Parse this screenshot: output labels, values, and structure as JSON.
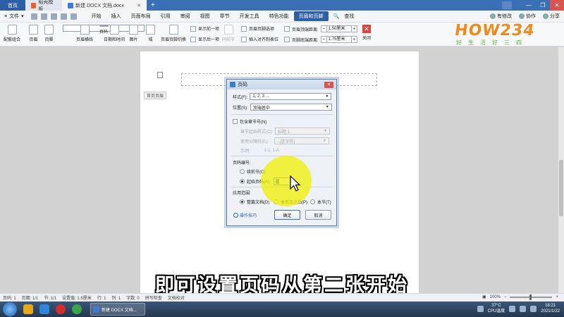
{
  "tabs": {
    "home": "首页",
    "template": "稻壳模板",
    "document": "新建 DOCX 文档.docx"
  },
  "menubar": {
    "file": "文件",
    "items": [
      "开始",
      "插入",
      "页面布局",
      "引用",
      "审阅",
      "视图",
      "章节",
      "开发工具",
      "特色功能",
      "页眉和页脚"
    ],
    "active_index": 9,
    "search": "查找",
    "right": [
      "有修改",
      "协作",
      "分享"
    ]
  },
  "ribbon": {
    "buttons": [
      "配套组合",
      "页眉",
      "页脚",
      "页码",
      "页眉横线",
      "日期和时间",
      "图片",
      "域",
      "页眉页脚切换",
      "同前节",
      "关闭"
    ],
    "small": {
      "show_prev": "显示前一项",
      "show_next": "显示后一项",
      "options": "页眉页脚选项",
      "insert_align_tab": "插入对齐制表位",
      "header_top": "页眉顶端距离:",
      "footer_bottom": "页脚底端距离:",
      "header_value": "1.50厘米",
      "footer_value": "1.75厘米"
    }
  },
  "logo": {
    "main": "HOW234",
    "sub": "好生活好三四"
  },
  "document": {
    "header_tag": "首页页眉"
  },
  "dialog": {
    "title": "页码",
    "style_label": "样式(F):",
    "style_value": "1, 2, 3 ...",
    "position_label": "位置(S):",
    "position_value": "顶端居中",
    "include_chapter": "包含章节号(N)",
    "chapter_start_label": "章节起始样式(C):",
    "chapter_start_value": "标题 1",
    "separator_label": "使用分隔符(E):",
    "separator_value": "-   (连字符)",
    "example_label": "示例:",
    "example_value": "1-1, 1-A",
    "numbering_label": "页码编号:",
    "continue_prev": "续前节(O)",
    "start_at": "起始页码(A):",
    "start_value": "1",
    "apply_label": "应用范围:",
    "apply_whole": "整篇文档(D)",
    "apply_this_after": "本页及之后(P)",
    "apply_section": "本节(T)",
    "tips": "操作技巧",
    "ok": "确定",
    "cancel": "取消"
  },
  "subtitle": "即可设置页码从第二张开始",
  "statusbar": {
    "items": [
      "页码: 1",
      "页面: 1/1",
      "节: 1/1",
      "设置值: 1.5厘米",
      "行: 1",
      "列: 1",
      "字数: 0",
      "拼写检查",
      "文档校对"
    ],
    "zoom": "100%"
  },
  "taskbar": {
    "task": "新建 DOCX 文档...",
    "temp": "37°C",
    "temp_label": "CPU温度",
    "time": "18:21",
    "date": "2021/1/22"
  },
  "colors": {
    "accent": "#2e5ea3",
    "logo_orange": "#f08a1c",
    "logo_green": "#5cb531",
    "highlight": "#f0f000"
  }
}
